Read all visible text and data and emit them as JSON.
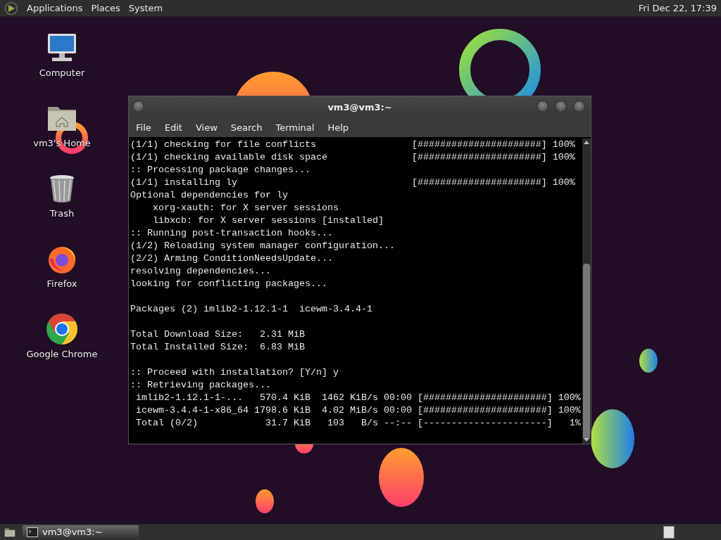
{
  "top_panel": {
    "menus": [
      "Applications",
      "Places",
      "System"
    ],
    "clock": "Fri Dec 22, 17:39"
  },
  "desktop_icons": [
    {
      "kind": "computer",
      "label": "Computer"
    },
    {
      "kind": "home",
      "label": "vm3's Home"
    },
    {
      "kind": "trash",
      "label": "Trash"
    },
    {
      "kind": "firefox",
      "label": "Firefox"
    },
    {
      "kind": "chrome",
      "label": "Google Chrome"
    }
  ],
  "terminal": {
    "title": "vm3@vm3:~",
    "menu": [
      "File",
      "Edit",
      "View",
      "Search",
      "Terminal",
      "Help"
    ],
    "blocks": [
      {
        "lines": [
          "(1/1) checking for file conflicts                 [######################] 100%",
          "(1/1) checking available disk space               [######################] 100%",
          ":: Processing package changes...",
          "(1/1) installing ly                               [######################] 100%",
          "Optional dependencies for ly",
          "    xorg-xauth: for X server sessions",
          "    libxcb: for X server sessions [installed]",
          ":: Running post-transaction hooks...",
          "(1/2) Reloading system manager configuration...",
          "(2/2) Arming ConditionNeedsUpdate...",
          "resolving dependencies...",
          "looking for conflicting packages..."
        ]
      },
      {
        "lines": [
          "Packages (2) imlib2-1.12.1-1  icewm-3.4.4-1"
        ]
      },
      {
        "lines": [
          "Total Download Size:   2.31 MiB",
          "Total Installed Size:  6.83 MiB"
        ]
      },
      {
        "lines": [
          ":: Proceed with installation? [Y/n] y",
          ":: Retrieving packages...",
          " imlib2-1.12.1-1-...   570.4 KiB  1462 KiB/s 00:00 [######################] 100%",
          " icewm-3.4.4-1-x86_64 1798.6 KiB  4.02 MiB/s 00:00 [######################] 100%",
          " Total (0/2)            31.7 KiB   103   B/s --:-- [----------------------]   1%"
        ]
      }
    ]
  },
  "taskbar": {
    "tasks": [
      {
        "label": "vm3@vm3:~",
        "selected": true
      }
    ]
  }
}
